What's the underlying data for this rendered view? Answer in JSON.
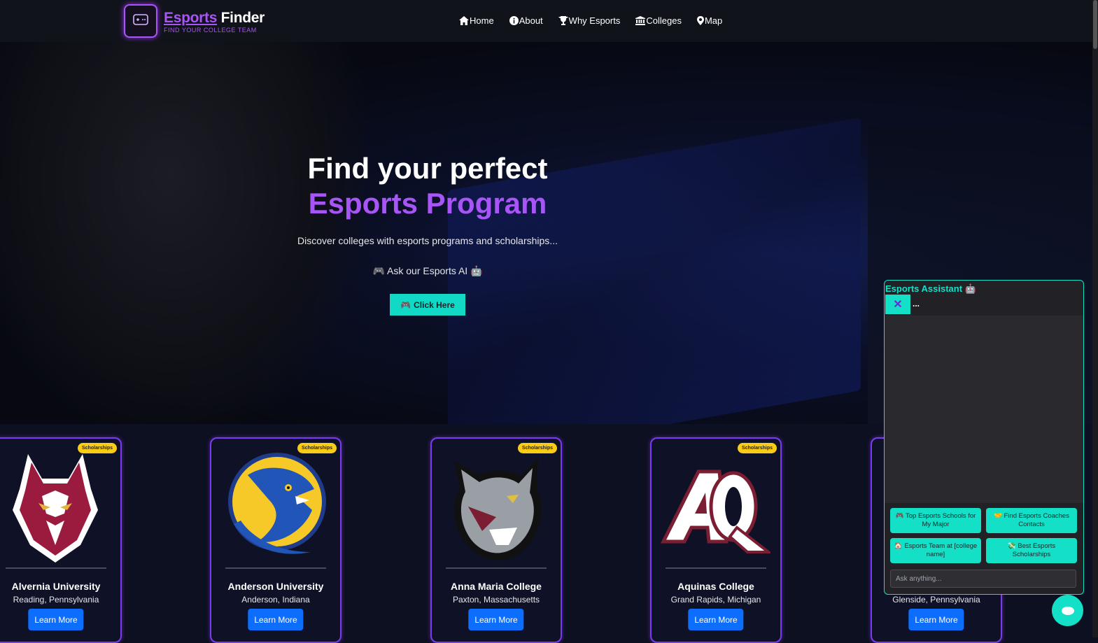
{
  "brand": {
    "title_part1": "Esports",
    "title_part2": "Finder",
    "tagline": "FIND YOUR COLLEGE TEAM"
  },
  "nav": [
    {
      "label": "Home",
      "icon": "home-icon"
    },
    {
      "label": "About",
      "icon": "info-icon"
    },
    {
      "label": "Why Esports",
      "icon": "trophy-icon"
    },
    {
      "label": "Colleges",
      "icon": "university-icon"
    },
    {
      "label": "Map",
      "icon": "map-pin-icon"
    }
  ],
  "hero": {
    "title_line1": "Find your perfect",
    "title_line2": "Esports Program",
    "description": "Discover colleges with esports programs and scholarships...",
    "ai_prompt": "Ask our Esports AI",
    "cta_label": "Click Here",
    "accent_color": "#a855f7",
    "cta_color": "#11d9c5"
  },
  "colleges": [
    {
      "name": "Alvernia University",
      "location": "Reading, Pennsylvania",
      "badge": "Scholarships",
      "button": "Learn More",
      "logo": "wolf-logo"
    },
    {
      "name": "Anderson University",
      "location": "Anderson, Indiana",
      "badge": "Scholarships",
      "button": "Learn More",
      "logo": "raven-logo"
    },
    {
      "name": "Anna Maria College",
      "location": "Paxton, Massachusetts",
      "badge": "Scholarships",
      "button": "Learn More",
      "logo": "amcat-logo"
    },
    {
      "name": "Aquinas College",
      "location": "Grand Rapids, Michigan",
      "badge": "Scholarships",
      "button": "Learn More",
      "logo": "aq-logo"
    },
    {
      "name": "",
      "location": "Glenside, Pennsylvania",
      "badge": "",
      "button": "Learn More",
      "logo": "partial-logo"
    }
  ],
  "chat": {
    "title": "Esports Assistant",
    "close_label": "✕",
    "typing": "...",
    "quick_actions": [
      {
        "icon": "🎮",
        "label": "Top Esports Schools for My Major"
      },
      {
        "icon": "🤝",
        "label": "Find Esports Coaches Contacts"
      },
      {
        "icon": "🏠",
        "label": "Esports Team at [college name]"
      },
      {
        "icon": "💸",
        "label": "Best Esports Scholarships"
      }
    ],
    "input_placeholder": "Ask anything...",
    "accent_color": "#14e0c8"
  }
}
